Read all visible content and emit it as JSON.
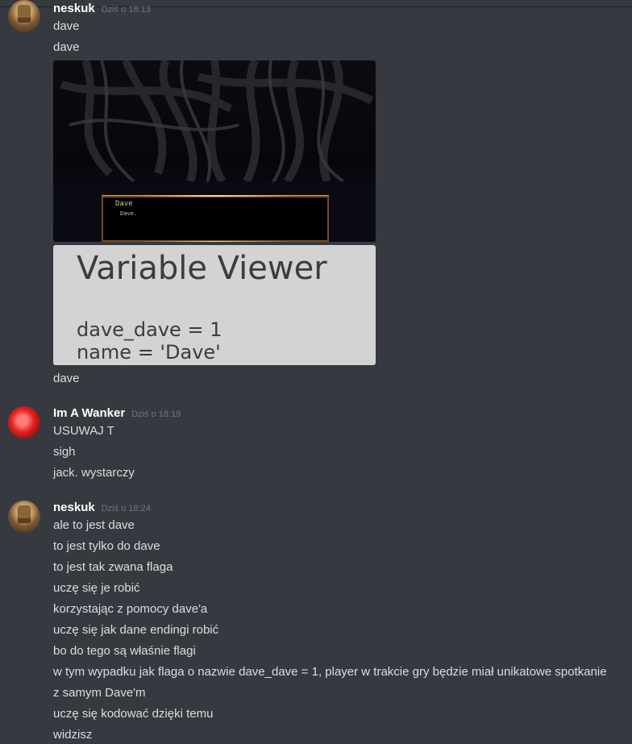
{
  "messages": [
    {
      "author": "neskuk",
      "timestamp": "Dziś o 18:13",
      "lines": [
        "dave",
        "dave"
      ],
      "game_screenshot": {
        "dialog_name": "Dave",
        "dialog_text": "Dave."
      },
      "variable_viewer": {
        "title": "Variable Viewer",
        "line1": "dave_dave = 1",
        "line2": "name = 'Dave'"
      },
      "after": "dave"
    },
    {
      "author": "Im A Wanker",
      "timestamp": "Dziś o 18:19",
      "lines": [
        "USUWAJ T",
        "sigh",
        "jack. wystarczy"
      ]
    },
    {
      "author": "neskuk",
      "timestamp": "Dziś o 18:24",
      "lines": [
        "ale to jest dave",
        "to jest tylko do dave",
        "to jest tak zwana flaga",
        "uczę się je robić",
        "korzystając z pomocy dave'a",
        "uczę się jak dane endingi robić",
        "bo do tego są właśnie flagi",
        "w tym wypadku jak flaga o nazwie dave_dave = 1, player w trakcie gry będzie miał unikatowe spotkanie",
        "z samym Dave'm",
        "uczę się kodować dzięki temu",
        "widzisz"
      ]
    }
  ],
  "colors": {
    "background": "#36393f",
    "text": "#dcddde",
    "username": "#ffffff",
    "timestamp": "#72767d"
  },
  "icons": {
    "avatar_neskuk": "avatar-icon",
    "avatar_wanker": "avatar-icon"
  }
}
